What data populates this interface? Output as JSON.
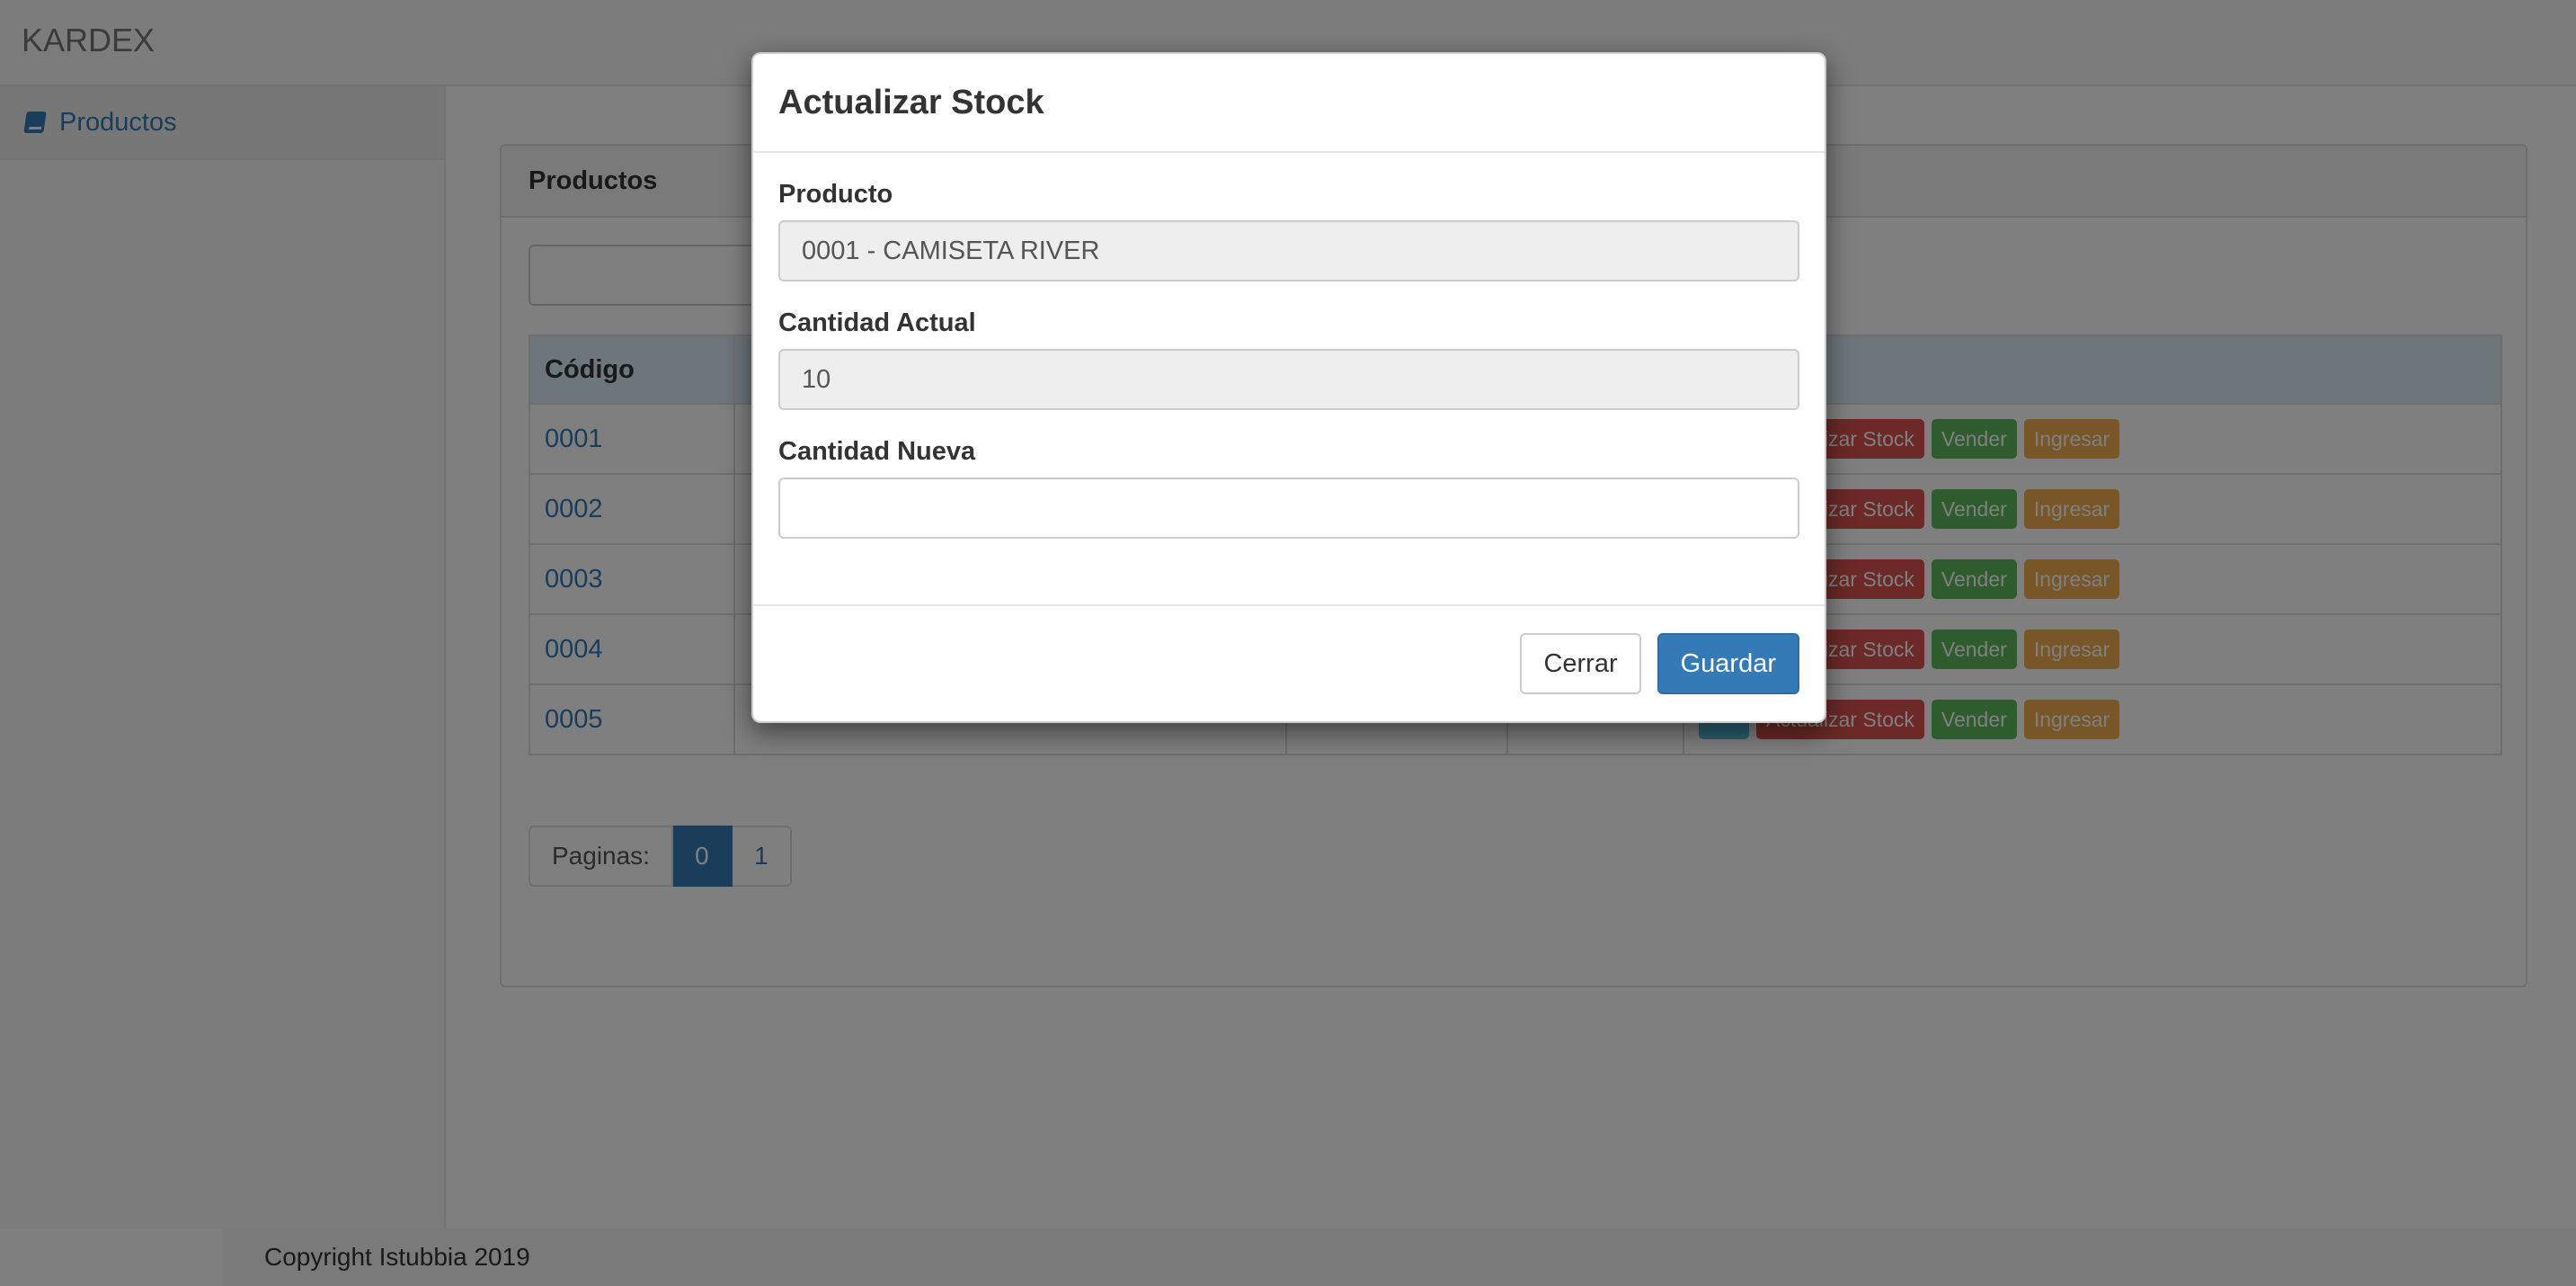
{
  "app": {
    "brand": "KARDEX"
  },
  "sidebar": {
    "items": [
      {
        "label": "Productos",
        "icon": "book-icon"
      }
    ]
  },
  "panel": {
    "title": "Productos",
    "search": {
      "value": "",
      "placeholder": ""
    }
  },
  "table": {
    "columns": [
      "Código",
      "",
      "",
      "",
      ""
    ],
    "rows": [
      {
        "code": "0001",
        "description": "",
        "price": "",
        "qty": ""
      },
      {
        "code": "0002",
        "description": "",
        "price": "",
        "qty": ""
      },
      {
        "code": "0003",
        "description": "",
        "price": "",
        "qty": ""
      },
      {
        "code": "0004",
        "description": "",
        "price": "",
        "qty": ""
      },
      {
        "code": "0005",
        "description": "",
        "price": "",
        "qty": ""
      }
    ],
    "actions": {
      "update": "Actualizar Stock",
      "sell": "Vender",
      "add": "Ingresar"
    }
  },
  "pagination": {
    "label": "Paginas:",
    "pages": [
      "0",
      "1"
    ],
    "active": "0"
  },
  "footer": {
    "text": "Copyright Istubbia 2019"
  },
  "modal": {
    "title": "Actualizar Stock",
    "product_label": "Producto",
    "product_value": "0001 - CAMISETA RIVER",
    "current_label": "Cantidad Actual",
    "current_value": "10",
    "new_label": "Cantidad Nueva",
    "new_value": "",
    "close_label": "Cerrar",
    "save_label": "Guardar"
  },
  "colors": {
    "primary": "#337ab7",
    "danger": "#d9534f",
    "success": "#5cb85c",
    "warning": "#f0ad4e",
    "info": "#5bc0de"
  }
}
